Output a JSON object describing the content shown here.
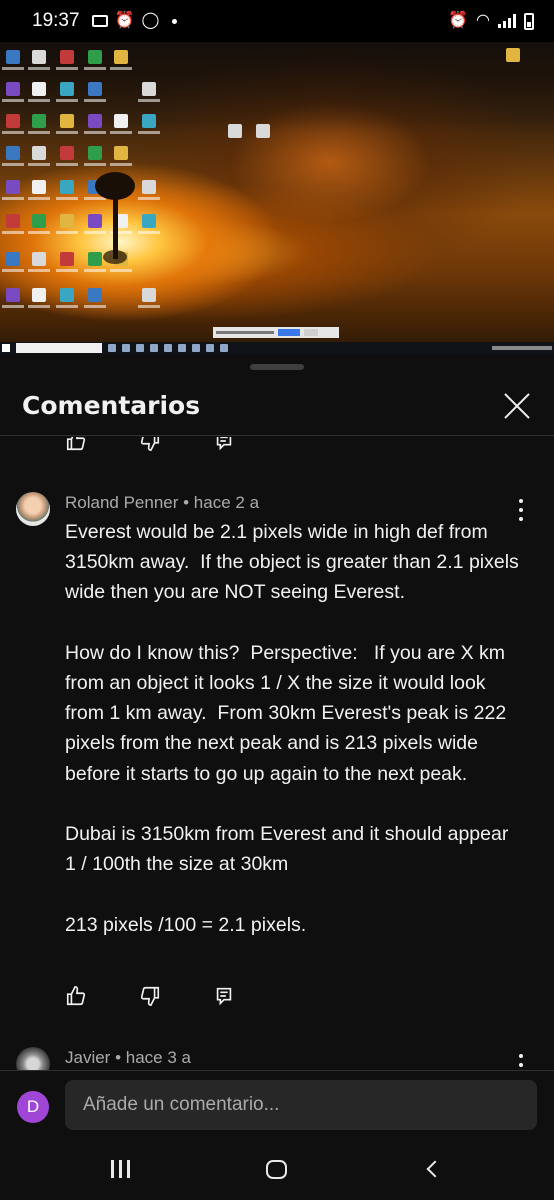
{
  "status_bar": {
    "time": "19:37",
    "left_icons": [
      "screen-icon",
      "alarm-icon",
      "whatsapp-icon",
      "dot-icon"
    ],
    "right_icons": [
      "alarm-icon",
      "wifi-icon",
      "signal-icon",
      "battery-icon"
    ]
  },
  "video": {
    "description_icons": "desktop-icons"
  },
  "panel": {
    "title": "Comentarios",
    "close_icon": "close-icon"
  },
  "comments": [
    {
      "author": "Roland Penner",
      "time": "hace 2 a",
      "meta": "Roland Penner • hace 2 a",
      "body": "Everest would be 2.1 pixels wide in high def from 3150km away.  If the object is greater than 2.1 pixels wide then you are NOT seeing Everest.\n\nHow do I know this?  Perspective:   If you are X km from an object it looks 1 / X the size it would look from 1 km away.  From 30km Everest's peak is 222 pixels from the next peak and is 213 pixels wide before it starts to go up again to the next peak.\n\nDubai is 3150km from Everest and it should appear  1 / 100th the size at 30km\n\n213 pixels /100 = 2.1 pixels."
    },
    {
      "author": "Javier",
      "time": "hace 3 a",
      "meta": "Javier • hace 3 a",
      "body": ""
    }
  ],
  "actions": [
    "like-icon",
    "dislike-icon",
    "reply-icon"
  ],
  "add_comment": {
    "avatar_letter": "D",
    "avatar_color": "#a046d6",
    "placeholder": "Añade un comentario..."
  },
  "nav": [
    "recents-icon",
    "home-icon",
    "back-icon"
  ]
}
